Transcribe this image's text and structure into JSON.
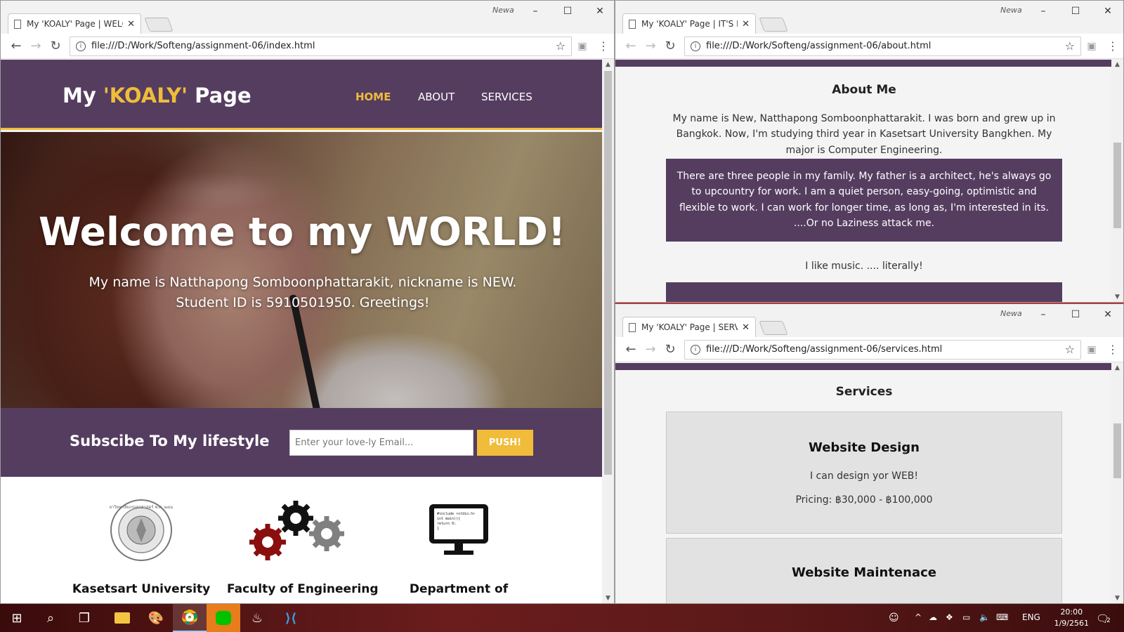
{
  "windows": {
    "main": {
      "tab_title": "My 'KOALY' Page | WELCO",
      "user": "Newa",
      "url": "file:///D:/Work/Softeng/assignment-06/index.html"
    },
    "about": {
      "tab_title": "My 'KOALY' Page | IT'S M",
      "user": "Newa",
      "url": "file:///D:/Work/Softeng/assignment-06/about.html"
    },
    "services": {
      "tab_title": "My 'KOALY' Page | SERVIC",
      "user": "Newa",
      "url": "file:///D:/Work/Softeng/assignment-06/services.html"
    }
  },
  "index_page": {
    "logo_prefix": "My ",
    "logo_highlight": "'KOALY'",
    "logo_suffix": " Page",
    "nav": [
      "HOME",
      "ABOUT",
      "SERVICES"
    ],
    "hero_title": "Welcome to my WORLD!",
    "hero_text": "My name is Natthapong Somboonphattarakit, nickname is NEW. Student ID is 5910501950. Greetings!",
    "subscribe_title": "Subscibe To My lifestyle",
    "email_placeholder": "Enter your love-ly Email...",
    "push_label": "PUSH!",
    "boxes": [
      "Kasetsart University",
      "Faculty of Engineering",
      "Department of"
    ],
    "seal_text": "มหาวิทยาลัยเกษตรศาสตร์ พ.ศ. ๒๔๘๖",
    "code_lines": [
      "#include <stdio.h>",
      "int main(){",
      "  return 0;",
      "}"
    ]
  },
  "about_page": {
    "heading": "About Me",
    "paragraph1": "My name is New, Natthapong Somboonphattarakit. I was born and grew up in Bangkok. Now, I'm studying third year in Kasetsart University Bangkhen. My major is Computer Engineering.",
    "paragraph2": "There are three people in my family. My father is a architect, he's always go to upcountry for work. I am a quiet person, easy-going, optimistic and flexible to work. I can work for longer time, as long as, I'm interested in its. ....Or no Laziness attack me.",
    "paragraph3": "I like music. .... literally!"
  },
  "services_page": {
    "heading": "Services",
    "items": [
      {
        "title": "Website Design",
        "desc": "I can design yor WEB!",
        "price": "Pricing: ฿30,000 - ฿100,000"
      },
      {
        "title": "Website Maintenace"
      }
    ]
  },
  "taskbar": {
    "language": "ENG",
    "time": "20:00",
    "date": "1/9/2561",
    "notification_count": "2"
  },
  "colors": {
    "purple": "#553d60",
    "yellow": "#f0bc3a",
    "taskbar": "#6b1d1d"
  }
}
